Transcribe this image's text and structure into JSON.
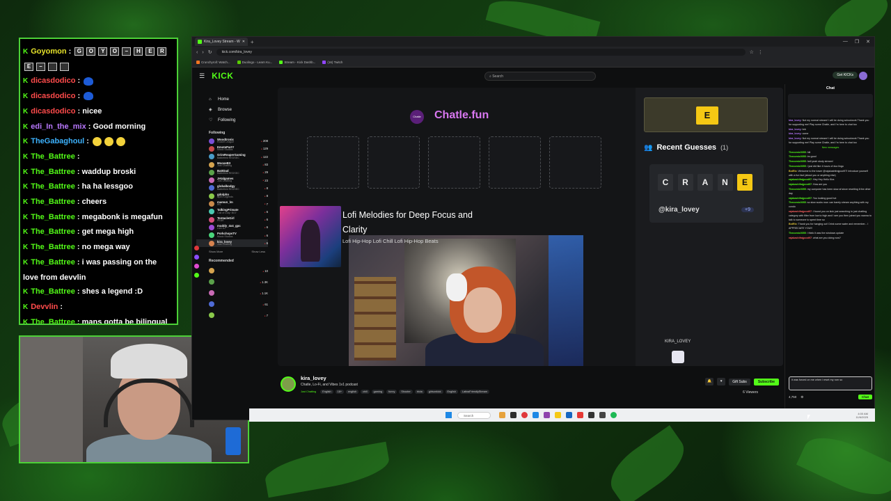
{
  "overlay_chat": {
    "lines": [
      {
        "user": "Goyomon",
        "color": "yellow",
        "text": "",
        "emotes": [
          "G",
          "O",
          "Y",
          "O",
          "–",
          "H",
          "E",
          "R",
          "E",
          "–",
          "emote",
          "emote"
        ]
      },
      {
        "user": "dicasdodico",
        "color": "red",
        "text": "",
        "emotes_blue": 1
      },
      {
        "user": "dicasdodico",
        "color": "red",
        "text": "",
        "emotes_blue": 1
      },
      {
        "user": "dicasdodico",
        "color": "red",
        "text": "nicee"
      },
      {
        "user": "edi_In_the_mix",
        "color": "purple",
        "text": "Good morning"
      },
      {
        "user": "TheGabaghoul",
        "color": "blue",
        "text": "",
        "emotes_round": 3
      },
      {
        "user": "The_Battree",
        "color": "green",
        "text": ""
      },
      {
        "user": "The_Battree",
        "color": "green",
        "text": "waddup broski"
      },
      {
        "user": "The_Battree",
        "color": "green",
        "text": "ha ha lessgoo"
      },
      {
        "user": "The_Battree",
        "color": "green",
        "text": "cheers"
      },
      {
        "user": "The_Battree",
        "color": "green",
        "text": "megabonk is megafun"
      },
      {
        "user": "The_Battree",
        "color": "green",
        "text": "get mega high"
      },
      {
        "user": "The_Battree",
        "color": "green",
        "text": "no mega way"
      },
      {
        "user": "The_Battree",
        "color": "green",
        "text": "i was passing on the love from devvlin"
      },
      {
        "user": "The_Battree",
        "color": "green",
        "text": "shes a legend :D"
      },
      {
        "user": "Devvlin",
        "color": "red",
        "text": ""
      },
      {
        "user": "The_Battree",
        "color": "green",
        "text": "mans gotta be bilingual first"
      }
    ]
  },
  "browser": {
    "tab_title": "Kira_Lovey Stream - W",
    "url": "kick.com/kira_lovey",
    "bookmarks": [
      "Crunchyroll: Watch...",
      "Duolingo - Learn Ku...",
      "Stream - Kick Dashb...",
      "(16) Twitch"
    ],
    "colors": {
      "kick_green": "#53fc18",
      "answer_yellow": "#f5c814",
      "chatle_pink": "#d877f0"
    }
  },
  "kick": {
    "logo": "KICK",
    "search_placeholder": "Search",
    "get_kicks": "Get KICKs",
    "nav": [
      {
        "label": "Home",
        "icon": "home-icon"
      },
      {
        "label": "Browse",
        "icon": "browse-icon"
      },
      {
        "label": "Following",
        "icon": "heart-icon"
      }
    ],
    "following_head": "Following",
    "recommended_head": "Recommended",
    "show_more": "Show More",
    "show_less": "Show Less",
    "following": [
      {
        "name": "Woodtronix",
        "cat": "Rocket League",
        "viewers": "208"
      },
      {
        "name": "EmotePartY",
        "cat": "Music Studios",
        "viewers": "129"
      },
      {
        "name": "GrimReaperGaming",
        "cat": "Battlefield REDSEC",
        "viewers": "122"
      },
      {
        "name": "MooseB3",
        "cat": "Just Chatting",
        "viewers": "83"
      },
      {
        "name": "BattDad",
        "cat": "Battlefield REDSEC",
        "viewers": "29"
      },
      {
        "name": "Jetalgames",
        "cat": "Just Chatting",
        "viewers": "23"
      },
      {
        "name": "globalbodgy",
        "cat": "Battlefield REDSEC",
        "viewers": "8"
      },
      {
        "name": "gdolphn",
        "cat": "Apex Legends",
        "viewers": "8"
      },
      {
        "name": "mamun_lm",
        "cat": "IRL",
        "viewers": "7"
      },
      {
        "name": "TalkingPrimate",
        "cat": "Call of Duty: BO7",
        "viewers": "6"
      },
      {
        "name": "TentacleGirl",
        "cat": "PEAK",
        "viewers": "6"
      },
      {
        "name": "muddy_4x4_gpc",
        "cat": "Live DJ",
        "viewers": "6"
      },
      {
        "name": "PorkchopsTV",
        "cat": "Music Studios",
        "viewers": "6"
      },
      {
        "name": "kira_lovey",
        "cat": "Just Chatting",
        "viewers": "6"
      }
    ],
    "recommended_viewers": [
      "10",
      "1.3K",
      "1.1K",
      "61",
      "7"
    ]
  },
  "stream": {
    "game_title": "Chatle.fun",
    "logo_text": "Chatle",
    "song_title": "Lofi Melodies for Deep Focus and Clarity",
    "song_sub": "Lofi Hip-Hop Lofi Chill Lofi Hip-Hop Beats",
    "answer_letter": "E",
    "recent_guesses_label": "Recent Guesses",
    "recent_count": "(1)",
    "guess_letters": [
      "C",
      "R",
      "A",
      "N",
      "E"
    ],
    "guess_user": "@kira_lovey",
    "guess_points": "+9",
    "overlay_name": "KIRA_LOVEY"
  },
  "streamer": {
    "name": "kira_lovey",
    "title": "Chatle, Lo-Fi, and Vibes  1v1  podcast",
    "category": "Just Chatting",
    "tags": [
      "English",
      "18+",
      "english",
      "chill",
      "gaming",
      "funny",
      "Shooter",
      "trivia",
      "girlsonkick",
      "English",
      "LatinaFriendlyStream"
    ],
    "gift_subs": "Gift Subs",
    "subscribe": "Subscribe",
    "viewers": "6 Viewers"
  },
  "kick_chat": {
    "title": "Chat",
    "messages": [
      {
        "user": "kira_lovey",
        "text": "Not my normal stream! I will be doing schoolwork Thank you for supporting me! Play some Chatle, and I'm here to chat too",
        "c": "p"
      },
      {
        "user": "kira_lovey",
        "text": "brb",
        "c": "p"
      },
      {
        "user": "kira_lovey",
        "text": "come",
        "c": "p"
      },
      {
        "user": "kira_lovey",
        "text": "Not my normal stream! I will be doing schoolwork Thank you for supporting me! Play some Chatle, and I'm here to chat too",
        "c": "p"
      },
      {
        "user": "",
        "text": "New messages",
        "c": "sys"
      },
      {
        "user": "Thecomic0055",
        "text": "hiii",
        "c": ""
      },
      {
        "user": "Thecomic0055",
        "text": "im good",
        "c": ""
      },
      {
        "user": "Thecomic0055",
        "text": "hell yeah study stream!",
        "c": ""
      },
      {
        "user": "Thecomic0055",
        "text": "i just did like 4 hours of duo lingo",
        "c": ""
      },
      {
        "user": "BotRix",
        "text": "Welcome to the tower @rajakashifrajpoot97! Introduce yourself with a fun fact (about you or anything else)",
        "c": "y"
      },
      {
        "user": "rajakashifrajpoot97",
        "text": "Hey Hey Hello Kira",
        "c": ""
      },
      {
        "user": "rajakashifrajpoot97",
        "text": "How are you",
        "c": ""
      },
      {
        "user": "Thecomic0055",
        "text": "my computer has been slow af since resetting it the other day",
        "c": ""
      },
      {
        "user": "rajakashifrajpoot97",
        "text": "You looking good hot",
        "c": ""
      },
      {
        "user": "Thecomic0055",
        "text": "so slow sucks now. can barely stream anything with my condo",
        "c": ""
      },
      {
        "user": "rajakashifrajpoot97",
        "text": "I found you on kick just searching in just chatting category with filter from low to high and I see you then joined you wanna to talk to someone to spent time so",
        "c": "r"
      },
      {
        "user": "BotRix",
        "text": "Thank you for hanging out! Drink some water and remember... I APPRECIATE YOU!!!",
        "c": "y"
      },
      {
        "user": "Thecomic0055",
        "text": "i think it was the windows update",
        "c": ""
      },
      {
        "user": "rajakashifrajpoot97",
        "text": "what are you doing now?",
        "c": "r"
      }
    ],
    "input_text": "it was forced on me when i reset my rom so",
    "points": "4,750",
    "chat_button": "Chat"
  },
  "taskbar": {
    "search": "Search",
    "time": "4:00 AM",
    "date": "11/6/2025"
  }
}
